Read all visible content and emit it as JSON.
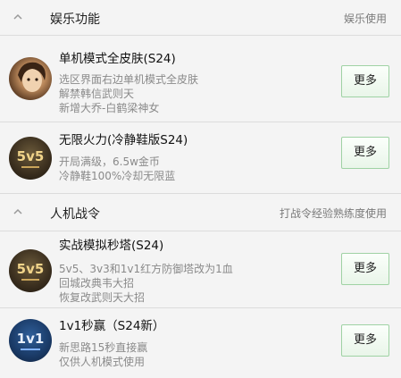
{
  "sections": [
    {
      "title": "娱乐功能",
      "right": "娱乐使用",
      "items": [
        {
          "name": "单机模式全皮肤(S24)",
          "desc": [
            "选区界面右边单机模式全皮肤",
            "解禁韩信武则天",
            "新增大乔-白鹤梁神女"
          ],
          "button": "更多",
          "avatar": "hero-portrait"
        },
        {
          "name": "无限火力(冷静鞋版S24)",
          "desc": [
            "开局满级，6.5w金币",
            "冷静鞋100%冷却无限蓝"
          ],
          "button": "更多",
          "avatar": "5v5-logo",
          "avatar_text": "5v5"
        }
      ]
    },
    {
      "title": "人机战令",
      "right": "打战令经验熟练度使用",
      "items": [
        {
          "name": "实战模拟秒塔(S24)",
          "desc": [
            "5v5、3v3和1v1红方防御塔改为1血",
            "回城改典韦大招",
            "恢复改武则天大招"
          ],
          "button": "更多",
          "avatar": "5v5-logo",
          "avatar_text": "5v5"
        },
        {
          "name": "1v1秒赢（S24新）",
          "desc": [
            "新思路15秒直接赢",
            "仅供人机模式使用"
          ],
          "button": "更多",
          "avatar": "1v1-logo",
          "avatar_text": "1v1"
        }
      ]
    }
  ],
  "colors": {
    "background": "#f4f4f4",
    "button_border": "#9fd2a4",
    "desc_text": "#8a8a8a"
  }
}
